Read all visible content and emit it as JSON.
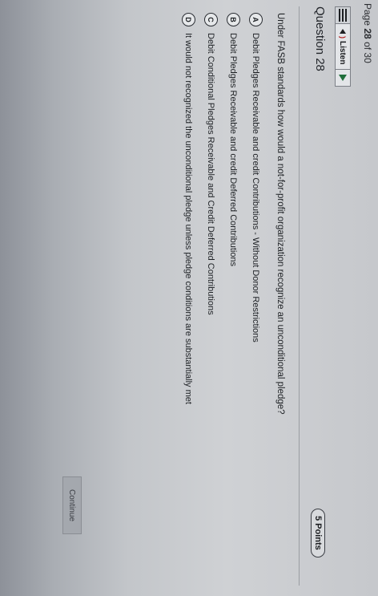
{
  "header": {
    "page_label": "Page",
    "page_current": "28",
    "page_of": "of 30"
  },
  "toolbar": {
    "listen_label": "Listen"
  },
  "question": {
    "title": "Question 28",
    "points": "5 Points",
    "text": "Under FASB standards how would a not-for-profit organization recognize an unconditional pledge?"
  },
  "options": [
    {
      "letter": "A",
      "text": "Debit Pledges Receivable and credit Contributions - Without Donor Restrictions"
    },
    {
      "letter": "B",
      "text": "Debit Pledges Receivable and credit Deferred Contributions"
    },
    {
      "letter": "C",
      "text": "Debit Conditional Pledges Receivable and Credit Deferred Contributions"
    },
    {
      "letter": "D",
      "text": "It would not recognized the unconditional pledge unless pledge conditions are substantially met"
    }
  ],
  "footer": {
    "continue_label": "Continue"
  }
}
